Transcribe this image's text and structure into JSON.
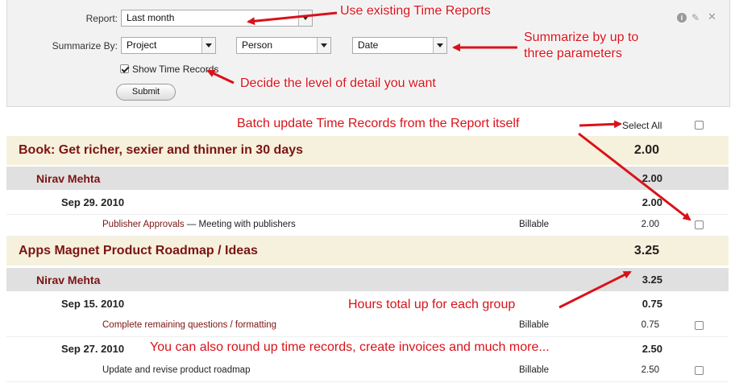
{
  "filters": {
    "report_label": "Report:",
    "report_value": "Last month",
    "summarize_label": "Summarize By:",
    "summarize_1": "Project",
    "summarize_2": "Person",
    "summarize_3": "Date",
    "show_time_records_label": "Show Time Records",
    "show_time_records_checked": true,
    "submit_label": "Submit"
  },
  "toolbar_icons": [
    "info-icon",
    "edit-icon",
    "close-icon"
  ],
  "select_all_label": "Select All",
  "groups": [
    {
      "project": "Book: Get richer, sexier and thinner in 30 days",
      "project_total": "2.00",
      "person": "Nirav Mehta",
      "person_total": "2.00",
      "dates": [
        {
          "date": "Sep 29. 2010",
          "date_total": "2.00",
          "records": [
            {
              "task": "Publisher Approvals",
              "separator": " — ",
              "description": "Meeting with publishers",
              "billable": "Billable",
              "hours": "2.00"
            }
          ]
        }
      ]
    },
    {
      "project": "Apps Magnet Product Roadmap / Ideas",
      "project_total": "3.25",
      "person": "Nirav Mehta",
      "person_total": "3.25",
      "dates": [
        {
          "date": "Sep 15. 2010",
          "date_total": "0.75",
          "records": [
            {
              "task": "Complete remaining questions / formatting",
              "separator": "",
              "description": "",
              "billable": "Billable",
              "hours": "0.75"
            }
          ]
        },
        {
          "date": "Sep 27. 2010",
          "date_total": "2.50",
          "records": [
            {
              "task": "",
              "separator": "",
              "description": "Update and revise product roadmap",
              "billable": "Billable",
              "hours": "2.50"
            }
          ]
        }
      ]
    }
  ],
  "annotations": {
    "existing_reports": "Use existing Time Reports",
    "summarize_line1": "Summarize by up to",
    "summarize_line2": "three parameters",
    "detail_level": "Decide the level of detail you want",
    "batch_update": "Batch update Time Records from the Report itself",
    "hours_total": "Hours total up for each group",
    "round_up": "You can also round up time records, create invoices and much more...",
    "color": "#d9121a"
  }
}
